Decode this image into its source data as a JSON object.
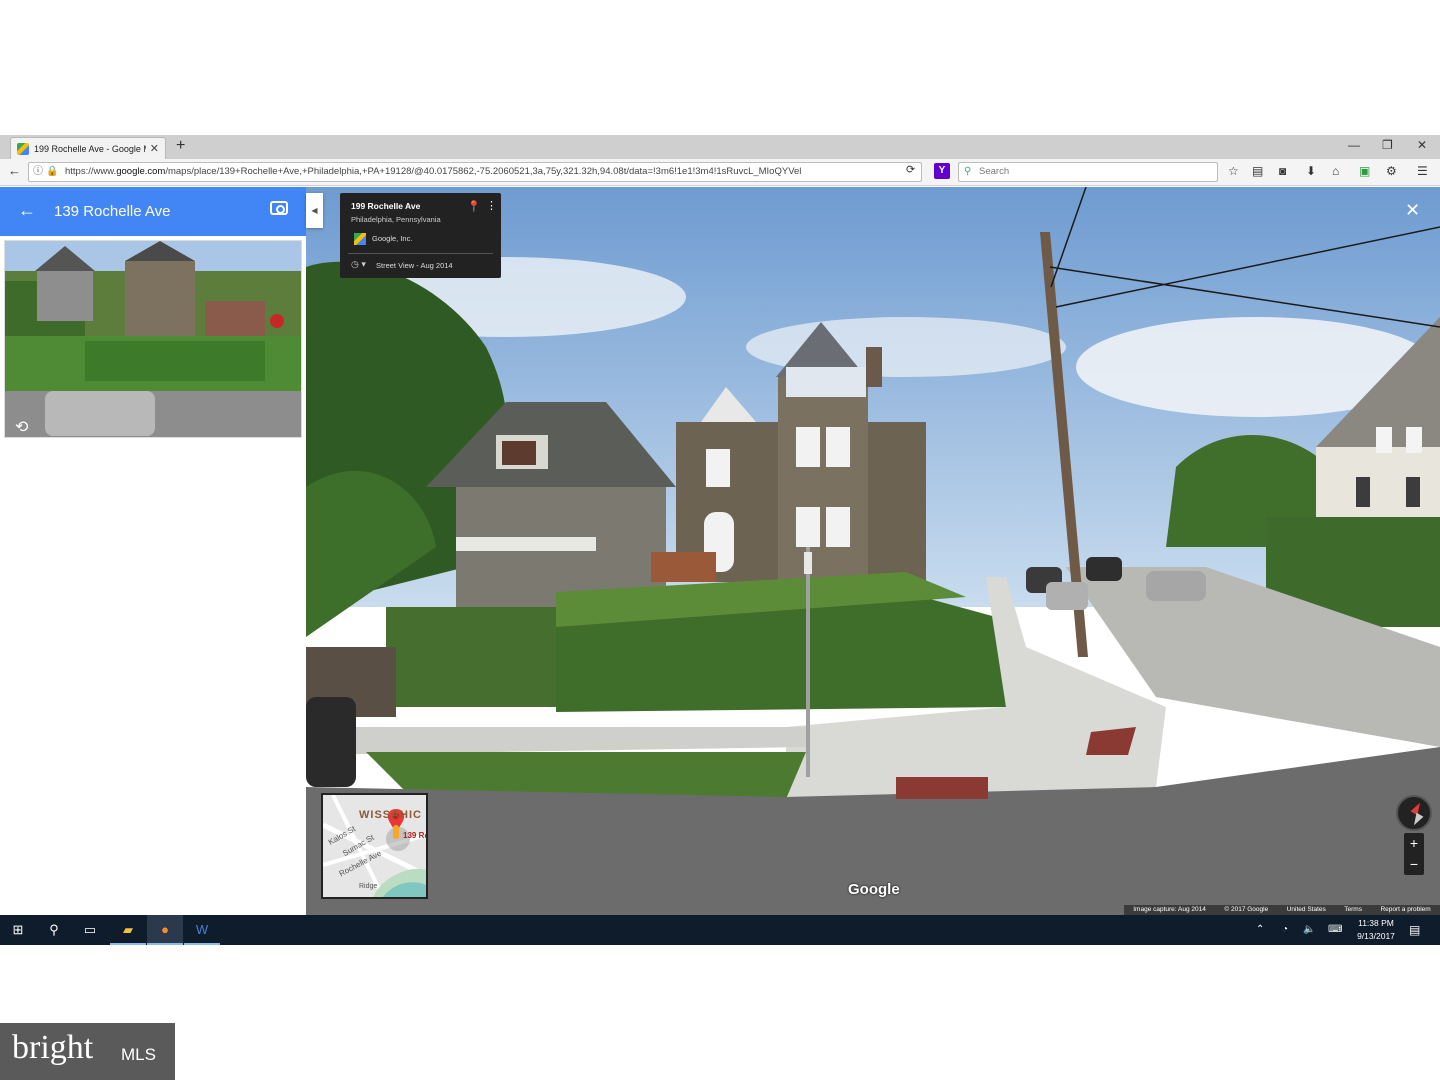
{
  "browser": {
    "tab_title": "199 Rochelle Ave - Google M",
    "tab_close": "✕",
    "new_tab": "+",
    "url_prefix": "https://www.",
    "url_host": "google.com",
    "url_rest": "/maps/place/139+Rochelle+Ave,+Philadelphia,+PA+19128/@40.0175862,-75.2060521,3a,75y,321.32h,94.08t/data=!3m6!1e1!3m4!1sRuvcL_MIoQYVel",
    "search_placeholder": "Search",
    "window_controls": [
      "—",
      "❐",
      "✕"
    ]
  },
  "side_panel": {
    "title": "139 Rochelle Ave",
    "back": "←"
  },
  "info_card": {
    "address": "199 Rochelle Ave",
    "city": "Philadelphia, Pennsylvania",
    "owner": "Google, Inc.",
    "date": "Street View - Aug 2014"
  },
  "street_view": {
    "close": "✕",
    "watermark": "Google",
    "zoom_in": "+",
    "zoom_out": "−",
    "footer": [
      "Image capture: Aug 2014",
      "© 2017 Google",
      "United States",
      "Terms",
      "Report a problem"
    ]
  },
  "minimap": {
    "labels": [
      "WISSAHIC",
      "Kalos St",
      "Sumac St",
      "Rochelle Ave",
      "139 Ro",
      "Ridge"
    ]
  },
  "taskbar": {
    "time": "11:38 PM",
    "date": "9/13/2017"
  },
  "watermark": {
    "brand": "bright",
    "suffix": "MLS"
  }
}
